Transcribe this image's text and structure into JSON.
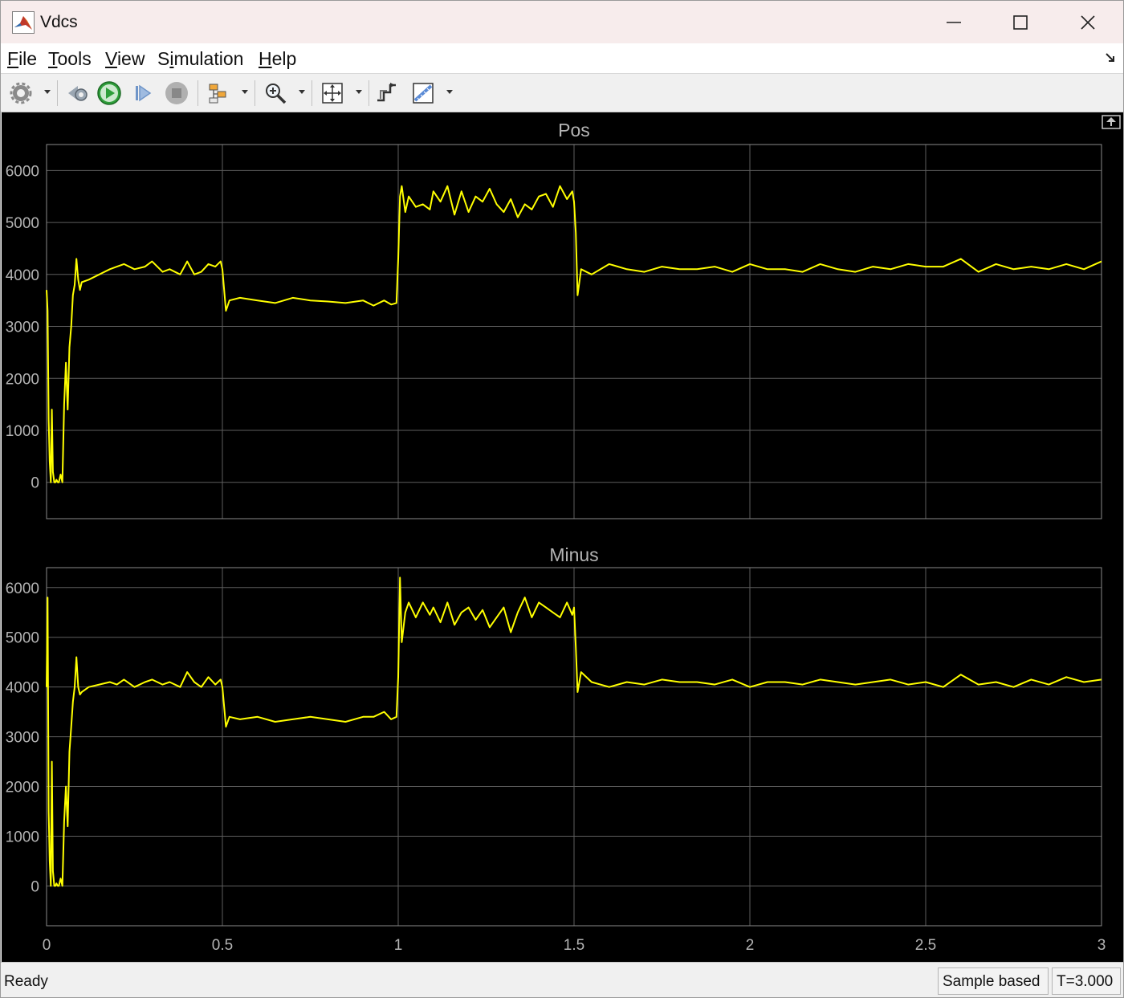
{
  "window": {
    "title": "Vdcs"
  },
  "menu": [
    {
      "label": "File",
      "hotkey": "F",
      "rest": "ile"
    },
    {
      "label": "Tools",
      "hotkey": "T",
      "rest": "ools"
    },
    {
      "label": "View",
      "hotkey": "V",
      "rest": "iew"
    },
    {
      "label": "Simulation",
      "hotkey": "i",
      "prefix": "S",
      "rest": "mulation"
    },
    {
      "label": "Help",
      "hotkey": "H",
      "rest": "elp"
    }
  ],
  "toolbar": {
    "icons": [
      "settings-icon",
      "step-back-icon",
      "run-icon",
      "step-forward-icon",
      "stop-icon",
      "highlight-block-icon",
      "zoom-in-icon",
      "autoscale-icon",
      "signal-selector-icon",
      "measurement-ruler-icon"
    ]
  },
  "colors": {
    "trace": "#ffff00",
    "grid": "#5e5e5e",
    "axes_bg": "#000000",
    "frame_bg": "#000000",
    "tick_text": "#b4b4b4",
    "title_text": "#b4b4b4"
  },
  "chart_data": [
    {
      "type": "line",
      "title": "Pos",
      "xlim": [
        0,
        3
      ],
      "ylim": [
        -700,
        6500
      ],
      "x_ticks": [
        0,
        0.5,
        1,
        1.5,
        2,
        2.5,
        3
      ],
      "y_ticks": [
        0,
        1000,
        2000,
        3000,
        4000,
        5000,
        6000
      ],
      "x_tick_labels_visible": false,
      "grid": true,
      "series": [
        {
          "color": "#ffff00",
          "x": [
            0,
            0.003,
            0.006,
            0.009,
            0.012,
            0.015,
            0.018,
            0.022,
            0.025,
            0.028,
            0.032,
            0.035,
            0.04,
            0.045,
            0.05,
            0.055,
            0.06,
            0.065,
            0.07,
            0.075,
            0.08,
            0.085,
            0.09,
            0.095,
            0.1,
            0.12,
            0.15,
            0.18,
            0.2,
            0.22,
            0.25,
            0.28,
            0.3,
            0.33,
            0.35,
            0.38,
            0.4,
            0.42,
            0.44,
            0.46,
            0.48,
            0.495,
            0.5,
            0.505,
            0.51,
            0.52,
            0.55,
            0.6,
            0.65,
            0.7,
            0.75,
            0.8,
            0.85,
            0.9,
            0.93,
            0.96,
            0.98,
            0.995,
            1.0,
            1.005,
            1.01,
            1.02,
            1.03,
            1.05,
            1.07,
            1.09,
            1.1,
            1.12,
            1.14,
            1.16,
            1.18,
            1.2,
            1.22,
            1.24,
            1.26,
            1.28,
            1.3,
            1.32,
            1.34,
            1.36,
            1.38,
            1.4,
            1.42,
            1.44,
            1.46,
            1.48,
            1.495,
            1.5,
            1.505,
            1.51,
            1.52,
            1.55,
            1.6,
            1.65,
            1.7,
            1.75,
            1.8,
            1.85,
            1.9,
            1.95,
            2.0,
            2.05,
            2.1,
            2.15,
            2.2,
            2.25,
            2.3,
            2.35,
            2.4,
            2.45,
            2.5,
            2.55,
            2.6,
            2.65,
            2.7,
            2.75,
            2.8,
            2.85,
            2.9,
            2.95,
            3.0
          ],
          "y": [
            3700,
            3300,
            1200,
            400,
            0,
            1400,
            200,
            0,
            0,
            50,
            0,
            0,
            150,
            0,
            1500,
            2300,
            1400,
            2600,
            3000,
            3600,
            3800,
            4300,
            3900,
            3700,
            3850,
            3900,
            4000,
            4100,
            4150,
            4200,
            4100,
            4150,
            4250,
            4050,
            4100,
            4000,
            4250,
            4000,
            4050,
            4200,
            4150,
            4250,
            4100,
            3700,
            3300,
            3500,
            3550,
            3500,
            3450,
            3550,
            3500,
            3480,
            3450,
            3500,
            3400,
            3500,
            3420,
            3450,
            4300,
            5500,
            5700,
            5200,
            5500,
            5300,
            5350,
            5250,
            5600,
            5400,
            5700,
            5150,
            5600,
            5200,
            5500,
            5400,
            5650,
            5350,
            5200,
            5450,
            5100,
            5350,
            5250,
            5500,
            5550,
            5300,
            5700,
            5450,
            5600,
            5400,
            4800,
            3600,
            4100,
            4000,
            4200,
            4100,
            4050,
            4150,
            4100,
            4100,
            4150,
            4050,
            4200,
            4100,
            4100,
            4050,
            4200,
            4100,
            4050,
            4150,
            4100,
            4200,
            4150,
            4150,
            4300,
            4050,
            4200,
            4100,
            4150,
            4100,
            4200,
            4100,
            4250
          ]
        }
      ]
    },
    {
      "type": "line",
      "title": "Minus",
      "xlim": [
        0,
        3
      ],
      "ylim": [
        -800,
        6400
      ],
      "x_ticks": [
        0,
        0.5,
        1,
        1.5,
        2,
        2.5,
        3
      ],
      "x_tick_labels": [
        "0",
        "0.5",
        "1",
        "1.5",
        "2",
        "2.5",
        "3"
      ],
      "y_ticks": [
        0,
        1000,
        2000,
        3000,
        4000,
        5000,
        6000
      ],
      "grid": true,
      "series": [
        {
          "color": "#ffff00",
          "x": [
            0,
            0.003,
            0.006,
            0.009,
            0.012,
            0.015,
            0.018,
            0.022,
            0.025,
            0.028,
            0.032,
            0.035,
            0.04,
            0.045,
            0.05,
            0.055,
            0.06,
            0.065,
            0.07,
            0.075,
            0.08,
            0.085,
            0.09,
            0.095,
            0.1,
            0.12,
            0.15,
            0.18,
            0.2,
            0.22,
            0.25,
            0.28,
            0.3,
            0.33,
            0.35,
            0.38,
            0.4,
            0.42,
            0.44,
            0.46,
            0.48,
            0.495,
            0.5,
            0.505,
            0.51,
            0.52,
            0.55,
            0.6,
            0.65,
            0.7,
            0.75,
            0.8,
            0.85,
            0.9,
            0.93,
            0.96,
            0.98,
            0.995,
            1.0,
            1.005,
            1.01,
            1.02,
            1.03,
            1.05,
            1.07,
            1.09,
            1.1,
            1.12,
            1.14,
            1.16,
            1.18,
            1.2,
            1.22,
            1.24,
            1.26,
            1.28,
            1.3,
            1.32,
            1.34,
            1.36,
            1.38,
            1.4,
            1.42,
            1.44,
            1.46,
            1.48,
            1.495,
            1.5,
            1.505,
            1.51,
            1.52,
            1.55,
            1.6,
            1.65,
            1.7,
            1.75,
            1.8,
            1.85,
            1.9,
            1.95,
            2.0,
            2.05,
            2.1,
            2.15,
            2.2,
            2.25,
            2.3,
            2.35,
            2.4,
            2.45,
            2.5,
            2.55,
            2.6,
            2.65,
            2.7,
            2.75,
            2.8,
            2.85,
            2.9,
            2.95,
            3.0
          ],
          "y": [
            4000,
            5800,
            1500,
            500,
            0,
            2500,
            300,
            0,
            0,
            50,
            0,
            0,
            150,
            0,
            1300,
            2000,
            1200,
            2700,
            3200,
            3700,
            4000,
            4600,
            4000,
            3850,
            3900,
            4000,
            4050,
            4100,
            4050,
            4150,
            4000,
            4100,
            4150,
            4050,
            4100,
            4000,
            4300,
            4100,
            4000,
            4200,
            4050,
            4150,
            4000,
            3600,
            3200,
            3400,
            3350,
            3400,
            3300,
            3350,
            3400,
            3350,
            3300,
            3400,
            3400,
            3500,
            3350,
            3400,
            4200,
            6200,
            4900,
            5500,
            5700,
            5400,
            5700,
            5450,
            5600,
            5300,
            5700,
            5250,
            5500,
            5600,
            5350,
            5550,
            5200,
            5400,
            5600,
            5100,
            5500,
            5800,
            5400,
            5700,
            5600,
            5500,
            5400,
            5700,
            5450,
            5600,
            4800,
            3900,
            4300,
            4100,
            4000,
            4100,
            4050,
            4150,
            4100,
            4100,
            4050,
            4150,
            4000,
            4100,
            4100,
            4050,
            4150,
            4100,
            4050,
            4100,
            4150,
            4050,
            4100,
            4000,
            4250,
            4050,
            4100,
            4000,
            4150,
            4050,
            4200,
            4100,
            4150
          ]
        }
      ]
    }
  ],
  "status": {
    "ready": "Ready",
    "sample_mode": "Sample based",
    "time": "T=3.000"
  }
}
